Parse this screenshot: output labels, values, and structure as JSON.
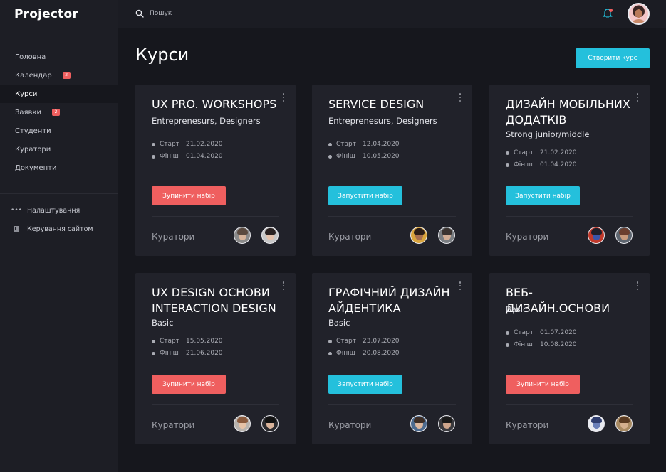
{
  "app": {
    "title": "Projector"
  },
  "search": {
    "placeholder": "Пошук"
  },
  "sidebar": {
    "items": [
      {
        "label": "Головна",
        "badge": null,
        "active": false
      },
      {
        "label": "Календар",
        "badge": "2",
        "active": false
      },
      {
        "label": "Курси",
        "badge": null,
        "active": true
      },
      {
        "label": "Заявки",
        "badge": "2",
        "active": false
      },
      {
        "label": "Студенти",
        "badge": null,
        "active": false
      },
      {
        "label": "Куратори",
        "badge": null,
        "active": false
      },
      {
        "label": "Документи",
        "badge": null,
        "active": false
      }
    ],
    "secondary": [
      {
        "label": "Налаштування",
        "icon": "more-dots-icon"
      },
      {
        "label": "Керування сайтом",
        "icon": "site-manage-icon"
      }
    ]
  },
  "main": {
    "title": "Курси",
    "create_label": "Створити курс",
    "courses": [
      {
        "title": "UX PRO. WORKSHOPS",
        "subtitle": "Entreprenesurs, Designers",
        "start_label": "Старт",
        "start": "21.02.2020",
        "finish_label": "Фініш",
        "finish": "01.04.2020",
        "action": "Зупинити набір",
        "action_color": "#ef5f5f",
        "curators_label": "Куратори"
      },
      {
        "title": "SERVICE DESIGN",
        "subtitle": "Entreprenesurs, Designers",
        "start_label": "Старт",
        "start": "12.04.2020",
        "finish_label": "Фініш",
        "finish": "10.05.2020",
        "action": "Запустити набір",
        "action_color": "#24c0dc",
        "curators_label": "Куратори"
      },
      {
        "title": "ДИЗАЙН МОБІЛЬНИХ ДОДАТКІВ",
        "subtitle": "Strong junior/middle",
        "start_label": "Старт",
        "start": "21.02.2020",
        "finish_label": "Фініш",
        "finish": "01.04.2020",
        "action": "Запустити набір",
        "action_color": "#24c0dc",
        "curators_label": "Куратори"
      },
      {
        "title": "UX DESIGN ОСНОВИ INTERACTION DESIGN",
        "subtitle": "Basic",
        "start_label": "Старт",
        "start": "15.05.2020",
        "finish_label": "Фініш",
        "finish": "21.06.2020",
        "action": "Зупинити набір",
        "action_color": "#ef5f5f",
        "curators_label": "Куратори"
      },
      {
        "title": "ГРАФІЧНИЙ ДИЗАЙН АЙДЕНТИКА",
        "subtitle": "Basic",
        "start_label": "Старт",
        "start": "23.07.2020",
        "finish_label": "Фініш",
        "finish": "20.08.2020",
        "action": "Запустити набір",
        "action_color": "#24c0dc",
        "curators_label": "Куратори"
      },
      {
        "title": "ВЕБ-ДИЗАЙН.ОСНОВИ",
        "subtitle": "Basic",
        "start_label": "Старт",
        "start": "01.07.2020",
        "finish_label": "Фініш",
        "finish": "10.08.2020",
        "action": "Зупинити набір",
        "action_color": "#ef5f5f",
        "curators_label": "Куратори"
      }
    ]
  },
  "colors": {
    "accent": "#24c0dc",
    "danger": "#ef5f5f",
    "background": "#16171d",
    "card": "#21222a",
    "sidebar": "#1d1e25"
  }
}
